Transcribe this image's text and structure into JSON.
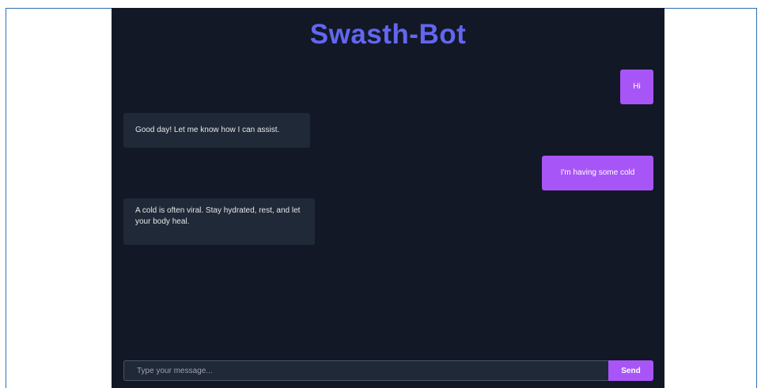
{
  "app": {
    "title": "Swasth-Bot",
    "colors": {
      "title": "#6366f1",
      "background": "#121826",
      "user_bubble": "#a855f7",
      "bot_bubble": "#1f2937"
    }
  },
  "messages": [
    {
      "sender": "user",
      "text": "Hi"
    },
    {
      "sender": "bot",
      "text": "Good day! Let me know how I can assist."
    },
    {
      "sender": "user",
      "text": "I'm having some cold"
    },
    {
      "sender": "bot",
      "text": "A cold is often viral. Stay hydrated, rest, and let your body heal."
    }
  ],
  "composer": {
    "placeholder": "Type your message...",
    "value": "",
    "send_label": "Send"
  }
}
